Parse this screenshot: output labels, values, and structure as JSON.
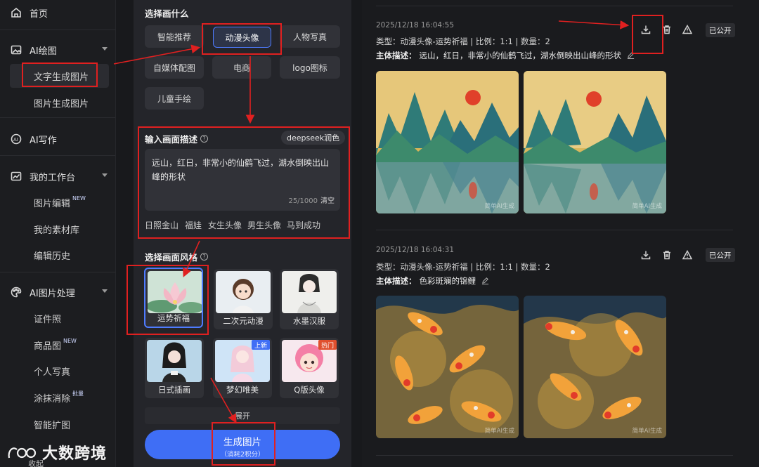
{
  "sidebar": {
    "home": "首页",
    "ai_draw": "AI绘图",
    "text_to_image": "文字生成图片",
    "image_to_image": "图片生成图片",
    "ai_write": "AI写作",
    "workspace": "我的工作台",
    "image_edit": "图片编辑",
    "image_edit_badge": "NEW",
    "my_materials": "我的素材库",
    "edit_history": "编辑历史",
    "ai_image_proc": "AI图片处理",
    "id_photo": "证件照",
    "product_image": "商品图",
    "product_image_badge": "NEW",
    "personal_photo": "个人写真",
    "erase": "涂抹消除",
    "erase_badge": "批量",
    "smart_expand": "智能扩图",
    "collapse": "收起"
  },
  "brand": {
    "name": "大数跨境"
  },
  "panel": {
    "choose_title": "选择画什么",
    "categories": [
      "智能推荐",
      "动漫头像",
      "人物写真",
      "自媒体配图",
      "电商",
      "logo图标",
      "儿童手绘"
    ],
    "active_category": "动漫头像",
    "prompt_title": "输入画面描述",
    "deepseek_label": "deepseek润色",
    "prompt_text": "远山，红日，非常小的仙鹤飞过，湖水倒映出山峰的形状",
    "prompt_count": "25/1000",
    "clear_label": "清空",
    "suggestions": [
      "日照金山",
      "福娃",
      "女生头像",
      "男生头像",
      "马到成功"
    ],
    "style_title": "选择画面风格",
    "styles": [
      {
        "label": "运势祈福",
        "badge": ""
      },
      {
        "label": "二次元动漫",
        "badge": ""
      },
      {
        "label": "水墨汉服",
        "badge": ""
      },
      {
        "label": "日式插画",
        "badge": ""
      },
      {
        "label": "梦幻唯美",
        "badge": "上新"
      },
      {
        "label": "Q版头像",
        "badge": "热门"
      }
    ],
    "expand_label": "展开",
    "generate_label": "生成图片",
    "generate_cost": "（消耗2积分）"
  },
  "results": [
    {
      "time": "2025/12/18 16:04:55",
      "meta": "类型：动漫头像-运势祈福 | 比例：1:1 | 数量：2",
      "desc_label": "主体描述：",
      "desc": "远山，红日，非常小的仙鹤飞过，湖水倒映出山峰的形状",
      "public_label": "已公开",
      "watermark": "简单AI生成"
    },
    {
      "time": "2025/12/18 16:04:31",
      "meta": "类型：动漫头像-运势祈福 | 比例：1:1 | 数量：2",
      "desc_label": "主体描述：",
      "desc": "色彩斑斓的锦鲤",
      "public_label": "已公开",
      "watermark": "简单AI生成"
    }
  ],
  "colors": {
    "accent": "#3f6ef5",
    "annotation": "#e02020"
  }
}
